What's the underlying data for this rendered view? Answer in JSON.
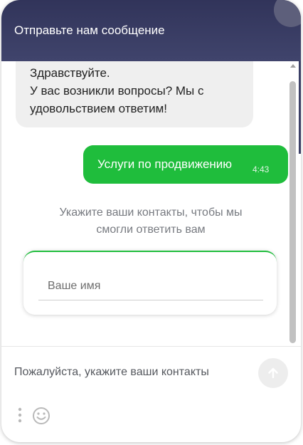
{
  "header": {
    "title": "Отправьте нам сообщение"
  },
  "messages": {
    "incoming": {
      "lines": [
        "Здравствуйте.",
        "У вас возникли вопросы? Мы с",
        "удовольствием ответим!"
      ]
    },
    "outgoing": {
      "text": "Услуги по продвижению",
      "time": "4:43"
    }
  },
  "prompt": {
    "lines": [
      "Укажите ваши контакты, чтобы мы",
      "смогли ответить вам"
    ]
  },
  "form": {
    "name_placeholder": "Ваше имя"
  },
  "composer": {
    "placeholder": "Пожалуйста, укажите ваши контакты"
  },
  "icons": {
    "send": "arrow-up-icon",
    "more": "vertical-dots-icon",
    "emoji": "smiley-icon"
  },
  "colors": {
    "header": "#31345a",
    "accent_green": "#1fbd3c",
    "incoming_bubble": "#efefef"
  }
}
